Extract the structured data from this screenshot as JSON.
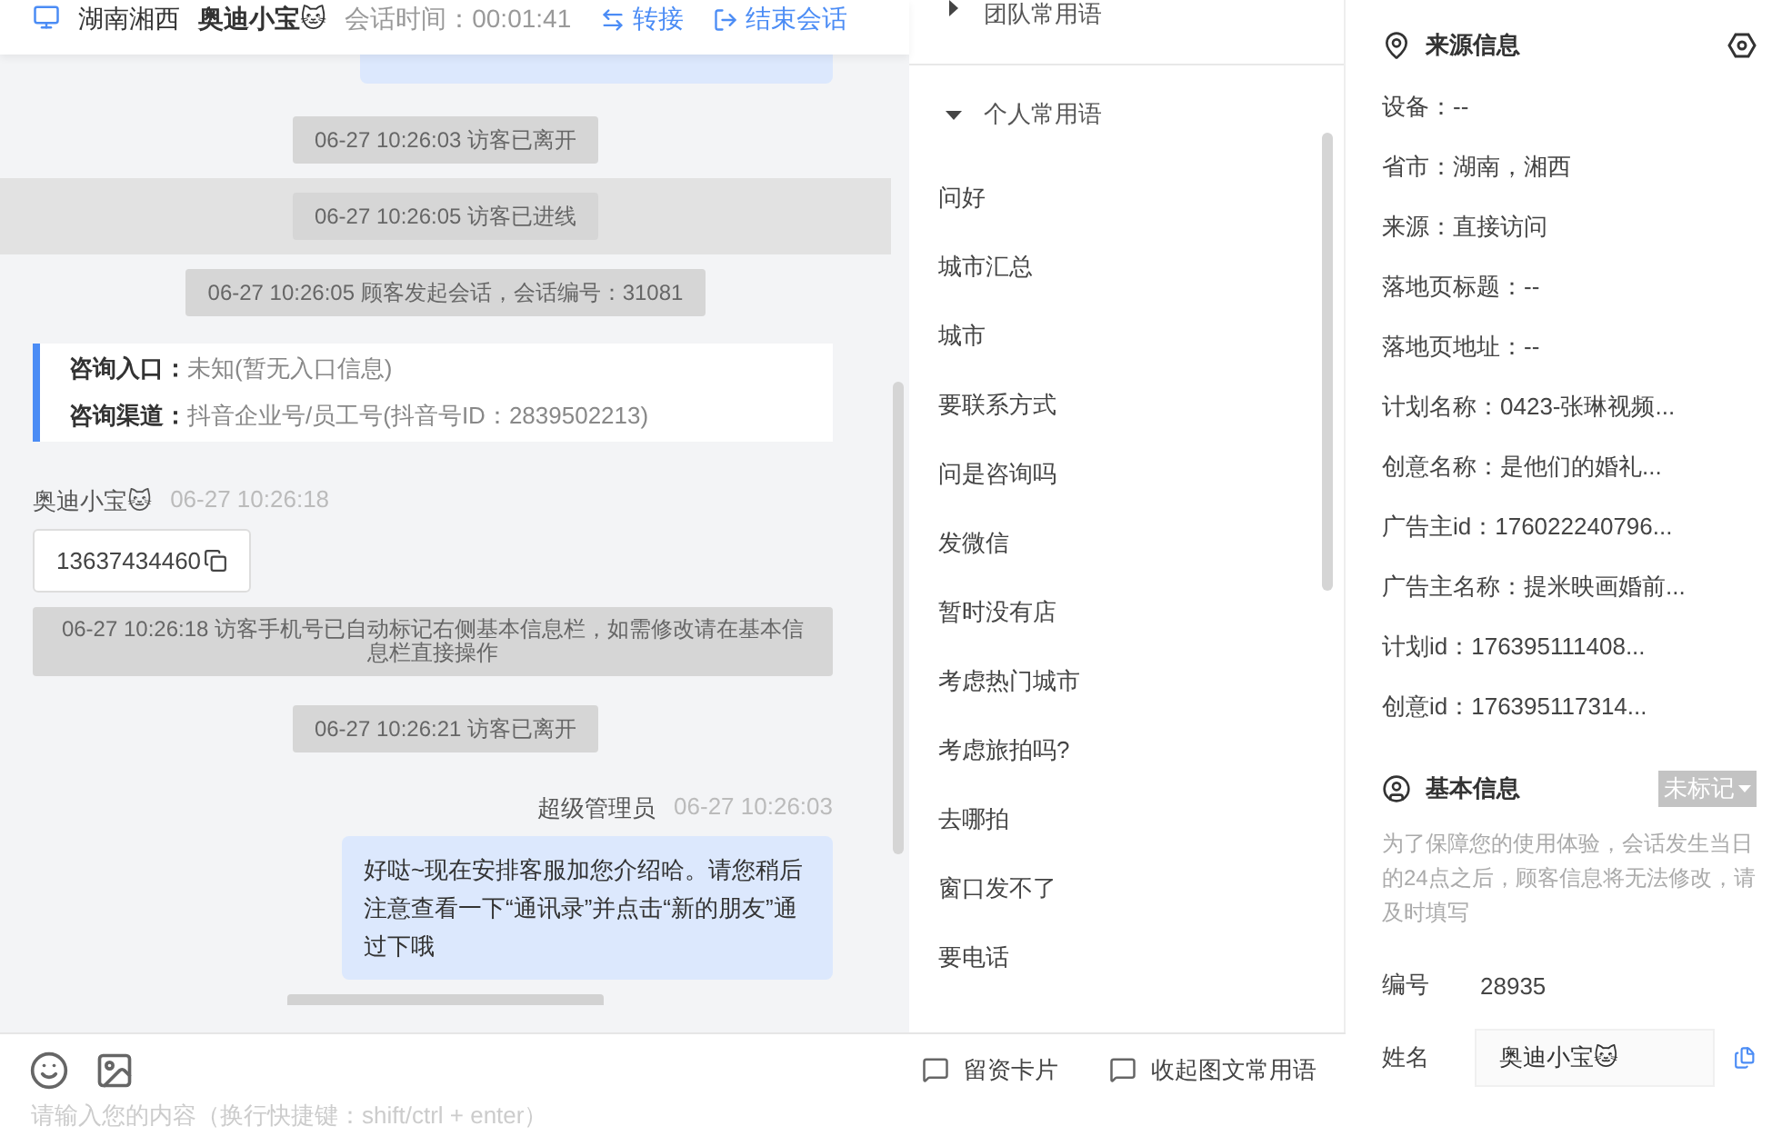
{
  "header": {
    "location": "湖南湘西",
    "visitor": "奥迪小宝🐱",
    "session_time": "会话时间：00:01:41",
    "actions": [
      {
        "kind": "transfer",
        "label": "转接"
      },
      {
        "kind": "end",
        "label": "结束会话"
      }
    ]
  },
  "chat": {
    "messages": [
      {
        "kind": "cut_bubble"
      },
      {
        "kind": "system",
        "text": "06-27 10:26:03 访客已离开",
        "highlighted": false
      },
      {
        "kind": "system",
        "text": "06-27 10:26:05 访客已进线",
        "highlighted": true
      },
      {
        "kind": "system",
        "text": "06-27 10:26:05 顾客发起会话，会话编号：31081",
        "highlighted": false
      },
      {
        "kind": "info_card",
        "rows": [
          {
            "label": "咨询入口：",
            "value": "未知(暂无入口信息)"
          },
          {
            "label": "咨询渠道：",
            "value": "抖音企业号/员工号(抖音号ID：2839502213)"
          }
        ]
      },
      {
        "kind": "visitor",
        "name": "奥迪小宝🐱",
        "time": "06-27 10:26:18",
        "text": "13637434460"
      },
      {
        "kind": "system_wide",
        "text": "06-27 10:26:18 访客手机号已自动标记右侧基本信息栏，如需修改请在基本信息栏直接操作"
      },
      {
        "kind": "system",
        "text": "06-27 10:26:21 访客已离开",
        "highlighted": false
      },
      {
        "kind": "agent",
        "name": "超级管理员",
        "time": "06-27 10:26:03",
        "text": "好哒~现在安排客服加您介绍哈。请您稍后注意查看一下“通讯录”并点击“新的朋友”通过下哦"
      },
      {
        "kind": "cut_system"
      }
    ]
  },
  "quick_replies": {
    "groups": [
      {
        "title": "团队常用语",
        "expanded": false
      },
      {
        "title": "个人常用语",
        "expanded": true,
        "items": [
          "问好",
          "城市汇总",
          "城市",
          "要联系方式",
          "问是咨询吗",
          "发微信",
          "暂时没有店",
          "考虑热门城市",
          "考虑旅拍吗?",
          "去哪拍",
          "窗口发不了",
          "要电话"
        ]
      }
    ]
  },
  "composer": {
    "actions": [
      "留资卡片",
      "收起图文常用语"
    ],
    "placeholder": "请输入您的内容（换行快捷键：shift/ctrl + enter）"
  },
  "source_info": {
    "title": "来源信息",
    "fields": [
      "设备：--",
      "省市：湖南，湘西",
      "来源：直接访问",
      "落地页标题：--",
      "落地页地址：--",
      "计划名称：0423-张琳视频...",
      "创意名称：是他们的婚礼...",
      "广告主id：176022240796...",
      "广告主名称：提米映画婚前...",
      "计划id：176395111408...",
      "创意id：176395117314..."
    ]
  },
  "basic_info": {
    "title": "基本信息",
    "tag": "未标记",
    "notice": "为了保障您的使用体验，会话发生当日的24点之后，顾客信息将无法修改，请及时填写",
    "fields": [
      {
        "kind": "text",
        "label": "编号",
        "value": "28935"
      },
      {
        "kind": "input",
        "label": "姓名",
        "value": "奥迪小宝🐱"
      }
    ]
  }
}
